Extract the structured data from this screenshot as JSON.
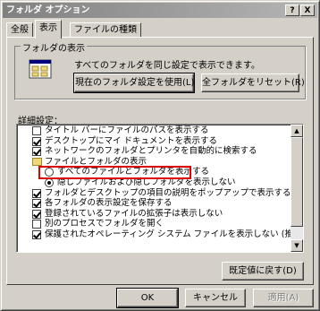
{
  "window": {
    "title": "フォルダ オプション",
    "help_button": "?",
    "close_button": "X"
  },
  "tabs": [
    {
      "label": "全般"
    },
    {
      "label": "表示"
    },
    {
      "label": "ファイルの種類"
    }
  ],
  "folder_view": {
    "group_label": "フォルダの表示",
    "description": "すべてのフォルダを同じ設定で表示できます。",
    "apply_button": "現在のフォルダ設定を使用(L)",
    "reset_button": "全フォルダをリセット(R)"
  },
  "advanced": {
    "label": "詳細設定：",
    "items": [
      {
        "text": "タイトル バーにファイルのパスを表示する",
        "control": "checkbox",
        "checked": false
      },
      {
        "text": "デスクトップにマイ ドキュメントを表示する",
        "control": "checkbox",
        "checked": true
      },
      {
        "text": "ネットワークのフォルダとプリンタを自動的に検索する",
        "control": "checkbox",
        "checked": true
      },
      {
        "text": "ファイルとフォルダの表示",
        "control": "folder",
        "checked": false
      },
      {
        "text": "すべてのファイルとフォルダを表示する",
        "control": "radio",
        "checked": false
      },
      {
        "text": "隠しファイルおよび隠しフォルダを表示しない",
        "control": "radio",
        "checked": true
      },
      {
        "text": "フォルダとデスクトップの項目の説明をポップアップで表示する",
        "control": "checkbox",
        "checked": true
      },
      {
        "text": "各フォルダの表示設定を保存する",
        "control": "checkbox",
        "checked": true
      },
      {
        "text": "登録されているファイルの拡張子は表示しない",
        "control": "checkbox",
        "checked": true
      },
      {
        "text": "別のプロセスでフォルダを開く",
        "control": "checkbox",
        "checked": false
      },
      {
        "text": "保護されたオペレーティング システム ファイルを表示しない (推奨)",
        "control": "checkbox",
        "checked": true
      }
    ],
    "restore_button": "既定値に戻す(D)"
  },
  "footer": {
    "ok": "OK",
    "cancel": "キャンセル",
    "apply": "適用(A)"
  },
  "colors": {
    "highlight_border": "#e00000",
    "dialog_face": "#d4d0c8"
  }
}
